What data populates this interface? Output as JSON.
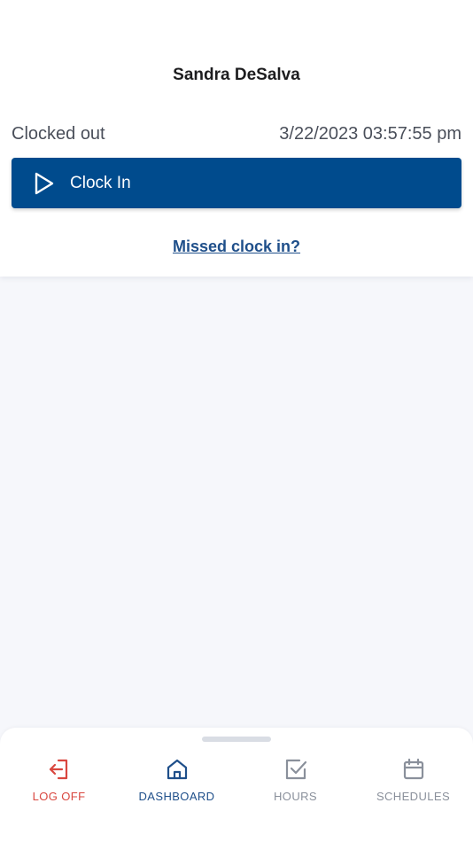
{
  "user": {
    "name": "Sandra DeSalva"
  },
  "status": {
    "state": "Clocked out",
    "datetime": "3/22/2023 03:57:55 pm"
  },
  "actions": {
    "clock_in_label": "Clock In",
    "missed_link": "Missed clock in?"
  },
  "nav": {
    "items": [
      {
        "label": "LOG OFF",
        "icon": "log-off-icon",
        "color": "#d9473f"
      },
      {
        "label": "DASHBOARD",
        "icon": "home-icon",
        "color": "#1f4f8a",
        "active": true
      },
      {
        "label": "HOURS",
        "icon": "checkbox-icon",
        "color": "#8a909b"
      },
      {
        "label": "SCHEDULES",
        "icon": "calendar-icon",
        "color": "#8a909b"
      }
    ]
  },
  "colors": {
    "primary": "#004b8d",
    "link": "#1f4f8a",
    "danger": "#d9473f",
    "muted": "#8a909b",
    "background": "#f6f7fb"
  }
}
